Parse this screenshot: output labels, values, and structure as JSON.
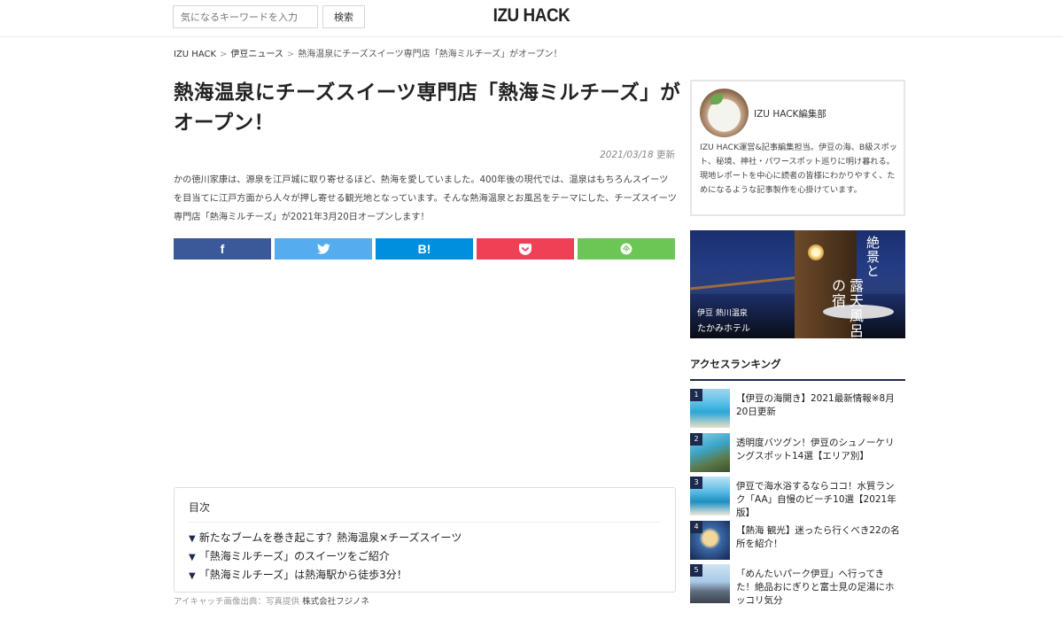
{
  "header": {
    "search_placeholder": "気になるキーワードを入力",
    "search_button": "検索",
    "logo": "IZU HACK"
  },
  "breadcrumb": {
    "home": "IZU HACK",
    "category": "伊豆ニュース",
    "current": "熱海温泉にチーズスイーツ専門店「熱海ミルチーズ」がオープン！"
  },
  "article": {
    "title": "熱海温泉にチーズスイーツ専門店「熱海ミルチーズ」がオープン！",
    "date": "2021/03/18",
    "date_suffix": "更新",
    "lead": "かの徳川家康は、源泉を江戸城に取り寄せるほど、熱海を愛していました。400年後の現代では、温泉はもちろんスイーツを目当てに江戸方面から人々が押し寄せる観光地となっています。そんな熱海温泉とお風呂をテーマにした、チーズスイーツ専門店「熱海ミルチーズ」が2021年3月20日オープンします！",
    "share": {
      "facebook": "f",
      "hatena": "B!"
    },
    "toc": {
      "title": "目次",
      "marker": "▼",
      "items": [
        "新たなブームを巻き起こす？熱海温泉×チーズスイーツ",
        "「熱海ミルチーズ」のスイーツをご紹介",
        "「熱海ミルチーズ」は熱海駅から徒歩3分！"
      ]
    },
    "caption": {
      "label": "アイキャッチ画像出典：写真提供",
      "credit": "株式会社フジノネ"
    }
  },
  "sidebar": {
    "profile": {
      "name": "IZU HACK編集部",
      "description": "IZU HACK運営&記事編集担当。伊豆の海、B級スポット、秘境、神社・パワースポット巡りに明け暮れる。現地レポートを中心に読者の皆様にわかりやすく、ためになるような記事製作を心掛けています。"
    },
    "banner": {
      "vertical_text_1": "絶景と",
      "vertical_text_2": "露天風呂の宿",
      "sub": "伊豆 熱川温泉",
      "hotel": "たかみホテル"
    },
    "ranking": {
      "heading": "アクセスランキング",
      "items": [
        {
          "num": "1",
          "text": "【伊豆の海開き】2021最新情報※8月20日更新"
        },
        {
          "num": "2",
          "text": "透明度バツグン！伊豆のシュノーケリングスポット14選【エリア別】"
        },
        {
          "num": "3",
          "text": "伊豆で海水浴するならココ！水質ランク「AA」自慢のビーチ10選【2021年版】"
        },
        {
          "num": "4",
          "text": "【熱海 観光】迷ったら行くべき22の名所を紹介！"
        },
        {
          "num": "5",
          "text": "「めんたいパーク伊豆」へ行ってきた！絶品おにぎりと富士見の足湯にホッコリ気分"
        }
      ]
    }
  }
}
